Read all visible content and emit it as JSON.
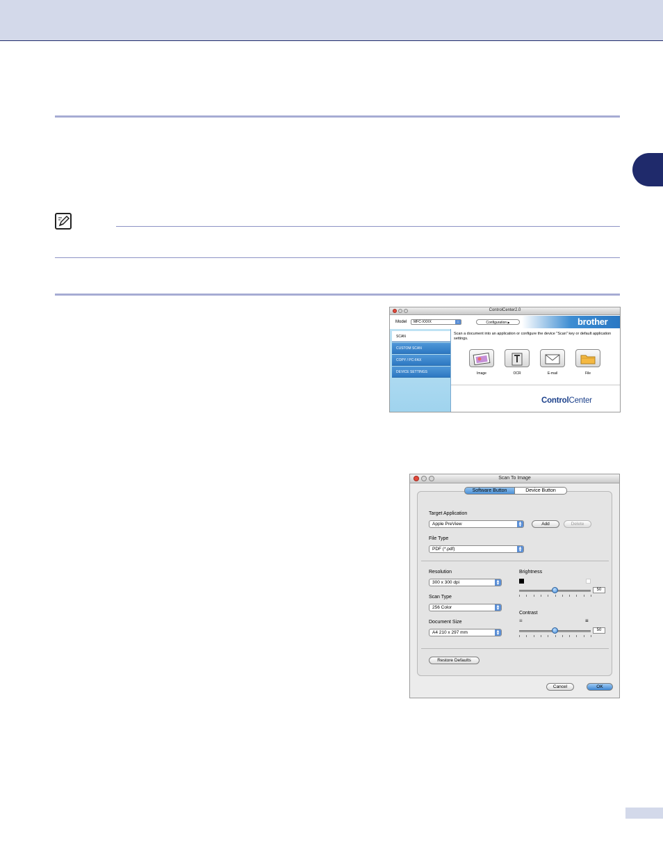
{
  "control_center": {
    "window_title": "ControlCenter2.0",
    "model_label": "Model",
    "model_value": "MFC-XXXX",
    "configuration_label": "Configuration",
    "brand": "brother",
    "sidebar": [
      {
        "label": "SCAN"
      },
      {
        "label": "CUSTOM SCAN"
      },
      {
        "label": "COPY / PC-FAX"
      },
      {
        "label": "DEVICE SETTINGS"
      }
    ],
    "description": "Scan a document into an application or configure the device \"Scan\" key or default application settings.",
    "buttons": [
      {
        "label": "Image",
        "icon": "image-icon"
      },
      {
        "label": "OCR",
        "icon": "ocr-icon"
      },
      {
        "label": "E-mail",
        "icon": "email-icon"
      },
      {
        "label": "File",
        "icon": "folder-icon"
      }
    ],
    "logo_bold": "Control",
    "logo_light": "Center"
  },
  "scan_dialog": {
    "window_title": "Scan To Image",
    "tabs": [
      "Software Button",
      "Device Button"
    ],
    "target_application_label": "Target Application",
    "target_application_value": "Apple PreView",
    "add_label": "Add",
    "delete_label": "Delete",
    "file_type_label": "File Type",
    "file_type_value": "PDF (*.pdf)",
    "resolution_label": "Resolution",
    "resolution_value": "300 x 300 dpi",
    "scan_type_label": "Scan Type",
    "scan_type_value": "256 Color",
    "document_size_label": "Document Size",
    "document_size_value": "A4 210 x 297 mm",
    "brightness_label": "Brightness",
    "brightness_value": "50",
    "contrast_label": "Contrast",
    "contrast_value": "50",
    "restore_defaults_label": "Restore Defaults",
    "cancel_label": "Cancel",
    "ok_label": "OK"
  },
  "colors": {
    "header_band": "#d3d9ea",
    "accent_navy": "#1f2a6b",
    "rule": "#a6abd3",
    "mac_blue": "#4d92d8"
  }
}
